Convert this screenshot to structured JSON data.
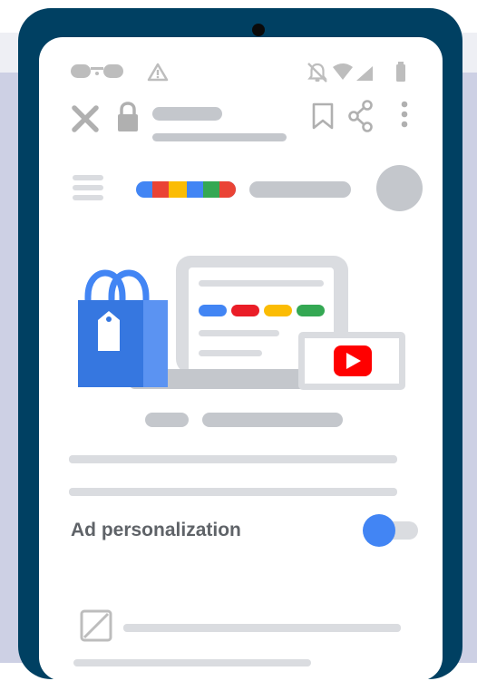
{
  "settings": {
    "ad_personalization_label": "Ad personalization",
    "ad_personalization_enabled": true
  },
  "icons": {
    "close": "close-icon",
    "lock": "lock-icon",
    "bookmark": "bookmark-icon",
    "share": "share-icon",
    "more": "more-vert-icon",
    "menu": "hamburger-menu-icon",
    "avatar": "avatar",
    "notifications_off": "notifications-off-icon",
    "wifi": "wifi-icon",
    "signal": "signal-icon",
    "battery": "battery-icon",
    "voicemail": "voicemail-icon",
    "warning": "warning-icon",
    "checkbox": "image-placeholder-icon"
  },
  "colors": {
    "frame": "#004062",
    "google_blue": "#4285f4",
    "google_red": "#ea4335",
    "google_yellow": "#fbbc04",
    "google_green": "#34a853",
    "youtube_red": "#ff0000",
    "placeholder_gray": "#c4c7cc"
  }
}
